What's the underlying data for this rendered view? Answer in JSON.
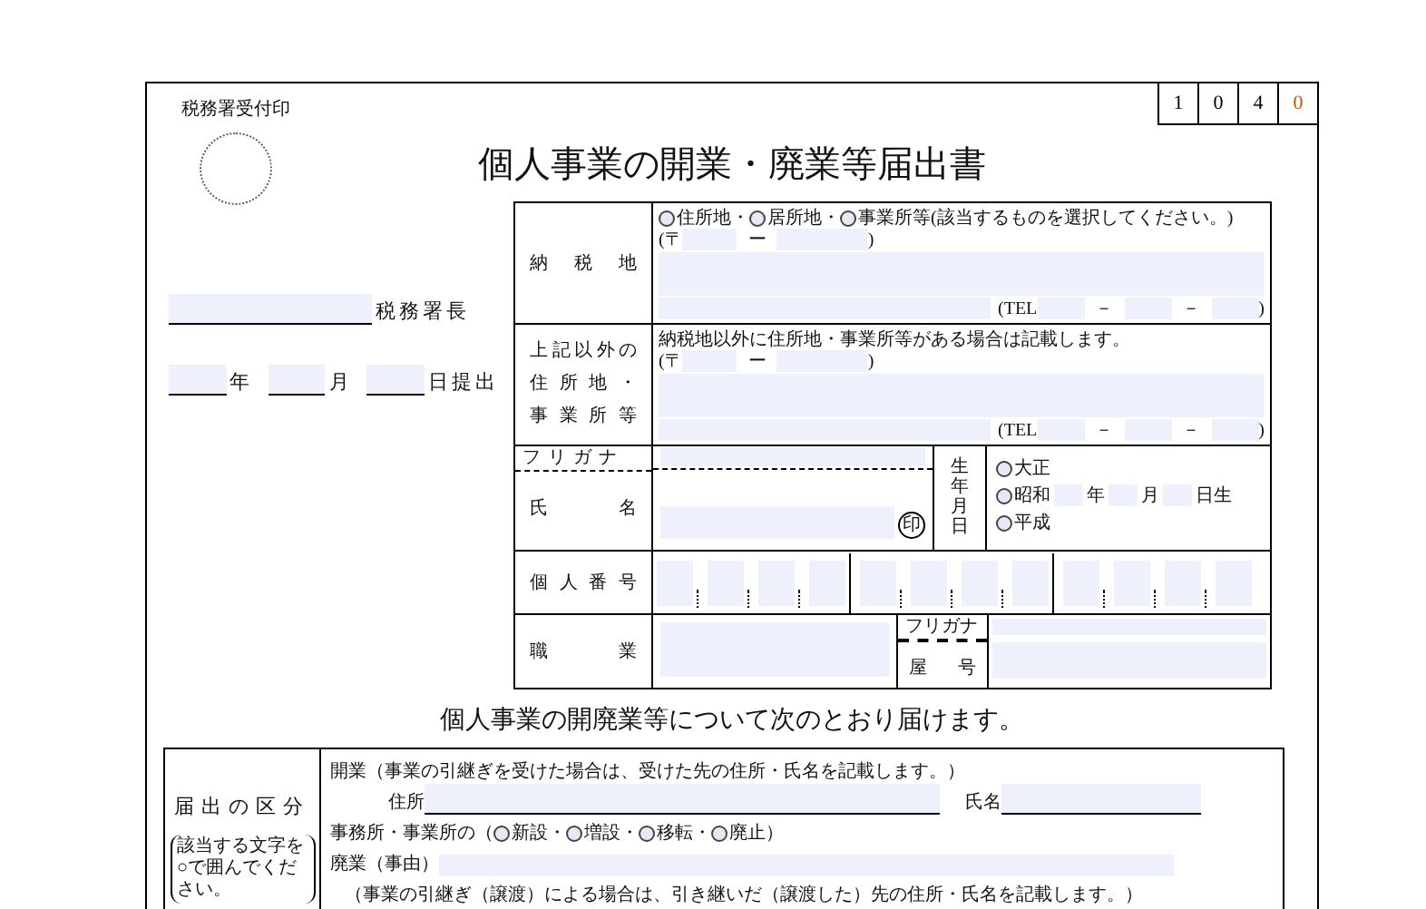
{
  "stamp_label": "税務署受付印",
  "form_code": [
    {
      "text": "1",
      "color": "#000000"
    },
    {
      "text": "0",
      "color": "#000000"
    },
    {
      "text": "4",
      "color": "#000000"
    },
    {
      "text": "0",
      "color": "#c05a00"
    }
  ],
  "title": "個人事業の開業・廃業等届出書",
  "office_suffix": "税務署長",
  "date_labels": [
    "年",
    "月",
    "日提出"
  ],
  "tax_place": {
    "label_lines": [
      "納税地"
    ],
    "options": [
      {
        "label": "住所地・",
        "selected": false
      },
      {
        "label": "居所地・",
        "selected": false
      },
      {
        "label": "事業所等",
        "selected": false
      }
    ],
    "note": "(該当するものを選択してください。)",
    "postal": [
      "(〒",
      "ー",
      ")"
    ],
    "tel": [
      "(TEL",
      "－",
      "－",
      ")"
    ]
  },
  "other_place": {
    "label_lines": [
      "上記以外の",
      "住所地・",
      "事業所等"
    ],
    "note": "納税地以外に住所地・事業所等がある場合は記載します。",
    "postal": [
      "(〒",
      "ー",
      ")"
    ],
    "tel": [
      "(TEL",
      "－",
      "－",
      ")"
    ]
  },
  "name": {
    "furigana_label": "フリガナ",
    "label": "氏名",
    "seal": "印",
    "birth_label": "生年月日",
    "eras": [
      {
        "label": "大正",
        "selected": false
      },
      {
        "label": "昭和",
        "selected": false
      },
      {
        "label": "平成",
        "selected": false
      }
    ],
    "date_labels": [
      "年",
      "月",
      "日生"
    ]
  },
  "personal_number": {
    "label": "個人番号"
  },
  "occupation": {
    "label": "職業",
    "furigana_label": "フリガナ",
    "trade_name_label": "屋号"
  },
  "statement": "個人事業の開廃業等について次のとおり届けます。",
  "category": {
    "label": "届出の区分",
    "hint": "該当する文字を○で囲んでください。",
    "opening": "開業（事業の引継ぎを受けた場合は、受けた先の住所・氏名を記載します。）",
    "address_label": "住所",
    "name_label": "氏名",
    "office_prefix": "事務所・事業所の（",
    "office_options": [
      {
        "label": "新設・",
        "selected": false
      },
      {
        "label": "増設・",
        "selected": false
      },
      {
        "label": "移転・",
        "selected": false
      },
      {
        "label": "廃止",
        "selected": false
      }
    ],
    "office_suffix": "）",
    "closing": "廃業（事由）",
    "transfer_note": "（事業の引継ぎ（譲渡）による場合は、引き継いだ（譲渡した）先の住所・氏名を記載します。）"
  }
}
